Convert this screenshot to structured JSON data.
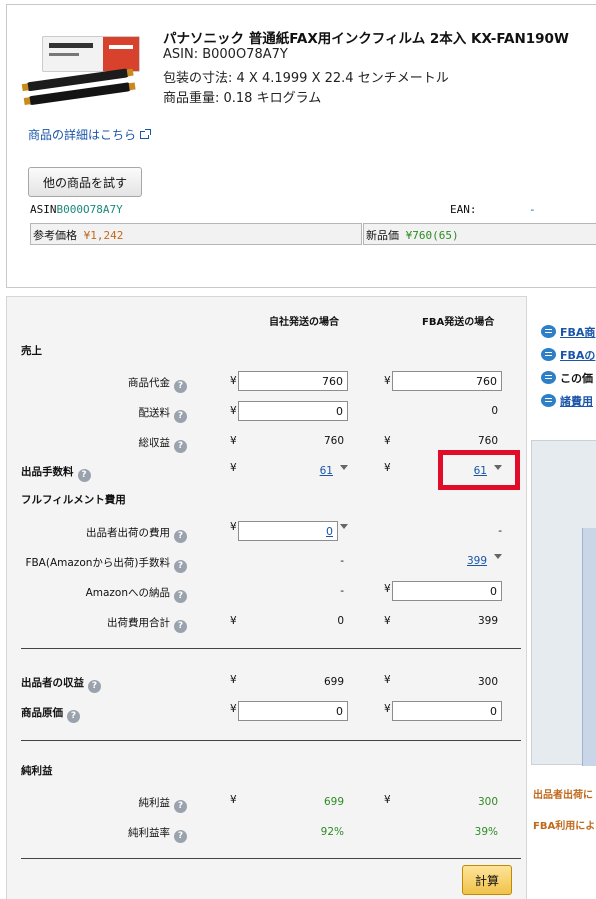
{
  "product": {
    "title": "パナソニック 普通紙FAX用インクフィルム 2本入 KX-FAN190W",
    "asin_line": "ASIN: B000O78A7Y",
    "dimensions_line": "包装の寸法: 4 X 4.1999 X 22.4 センチメートル",
    "weight_line": "商品重量: 0.18 キログラム",
    "details_link": "商品の詳細はこちら",
    "try_other_button": "他の商品を試す",
    "asin_label": "ASIN",
    "asin_value": "B000O78A7Y",
    "ean_label": "EAN:",
    "ean_value": "-",
    "ref_price_label": "参考価格",
    "ref_price_value": "¥1,242",
    "new_price_label": "新品価",
    "new_price_value": "¥760(65)"
  },
  "calc": {
    "col_self": "自社発送の場合",
    "col_fba": "FBA発送の場合",
    "currency": "¥",
    "sales_heading": "売上",
    "rows": {
      "item_price": {
        "label": "商品代金",
        "self": "760",
        "fba": "760"
      },
      "shipping": {
        "label": "配送料",
        "self": "0",
        "fba": "0"
      },
      "gross": {
        "label": "総収益",
        "self": "760",
        "fba": "760"
      },
      "selling_fee": {
        "label": "出品手数料",
        "self": "61",
        "fba": "61"
      },
      "fulfillment_heading": "フルフィルメント費用",
      "seller_ship_cost": {
        "label": "出品者出荷の費用",
        "self": "0",
        "fba": "-"
      },
      "fba_fee": {
        "label": "FBA(Amazonから出荷)手数料",
        "self": "-",
        "fba": "399"
      },
      "inbound": {
        "label": "Amazonへの納品",
        "self": "-",
        "fba": "0"
      },
      "ship_total": {
        "label": "出荷費用合計",
        "self": "0",
        "fba": "399"
      },
      "seller_revenue": {
        "label": "出品者の収益",
        "self": "699",
        "fba": "300"
      },
      "cost": {
        "label": "商品原価",
        "self": "0",
        "fba": "0"
      },
      "net_heading": "純利益",
      "net_profit": {
        "label": "純利益",
        "self": "699",
        "fba": "300"
      },
      "net_margin": {
        "label": "純利益率",
        "self": "92%",
        "fba": "39%"
      }
    },
    "calc_button": "計算"
  },
  "side": {
    "link1": "FBA商",
    "link2": "FBAの",
    "link3": "この価",
    "link4": "諸費用",
    "note1": "出品者出荷に",
    "note2": "FBA利用によ"
  },
  "colors": {
    "highlight": "#e00c2a",
    "link": "#1a55a8",
    "profit_green": "#2e8b24",
    "note_orange": "#c0691c",
    "calc_button": "#f1c24a"
  }
}
